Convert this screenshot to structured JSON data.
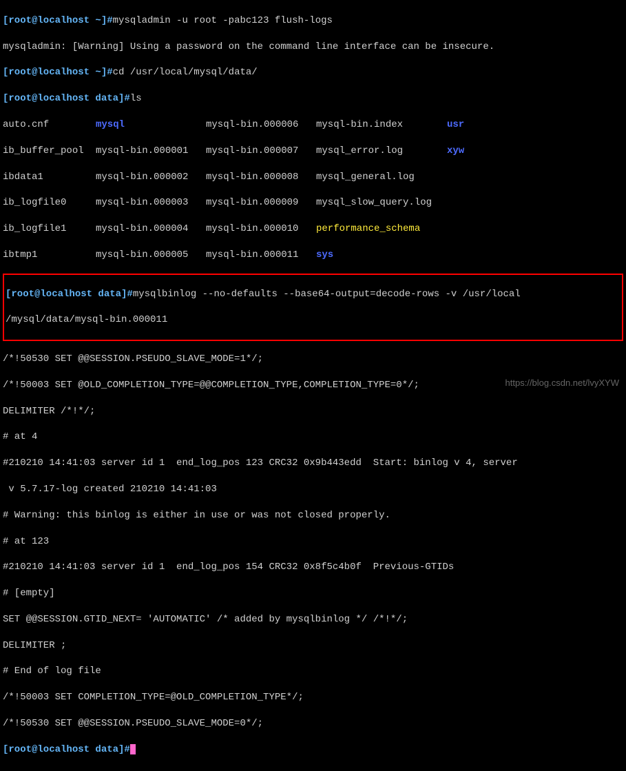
{
  "prompts": {
    "home": "[root@localhost ~]#",
    "data": "[root@localhost data]#"
  },
  "commands": {
    "cmd1": "mysqladmin -u root -pabc123 flush-logs",
    "warning": "mysqladmin: [Warning] Using a password on the command line interface can be insecure.",
    "cmd2": "cd /usr/local/mysql/data/",
    "cmd3": "ls",
    "cmd4_line1": "mysqlbinlog --no-defaults --base64-output=decode-rows -v /usr/local",
    "cmd4_line2": "/mysql/data/mysql-bin.000011"
  },
  "ls": {
    "rows": [
      {
        "c1": "auto.cnf",
        "c2": "mysql",
        "c2cls": "dir",
        "c3": "mysql-bin.000006",
        "c4": "mysql-bin.index",
        "c5": "usr",
        "c5cls": "dir"
      },
      {
        "c1": "ib_buffer_pool",
        "c2": "mysql-bin.000001",
        "c2cls": "",
        "c3": "mysql-bin.000007",
        "c4": "mysql_error.log",
        "c5": "xyw",
        "c5cls": "dir"
      },
      {
        "c1": "ibdata1",
        "c2": "mysql-bin.000002",
        "c2cls": "",
        "c3": "mysql-bin.000008",
        "c4": "mysql_general.log",
        "c5": "",
        "c5cls": ""
      },
      {
        "c1": "ib_logfile0",
        "c2": "mysql-bin.000003",
        "c2cls": "",
        "c3": "mysql-bin.000009",
        "c4": "mysql_slow_query.log",
        "c5": "",
        "c5cls": ""
      },
      {
        "c1": "ib_logfile1",
        "c2": "mysql-bin.000004",
        "c2cls": "",
        "c3": "mysql-bin.000010",
        "c4": "performance_schema",
        "c4cls": "perf",
        "c5": "",
        "c5cls": ""
      },
      {
        "c1": "ibtmp1",
        "c2": "mysql-bin.000005",
        "c2cls": "",
        "c3": "mysql-bin.000011",
        "c4": "sys",
        "c4cls": "sys",
        "c5": "",
        "c5cls": ""
      }
    ]
  },
  "output": {
    "l1": "/*!50530 SET @@SESSION.PSEUDO_SLAVE_MODE=1*/;",
    "l2": "/*!50003 SET @OLD_COMPLETION_TYPE=@@COMPLETION_TYPE,COMPLETION_TYPE=0*/;",
    "l3": "DELIMITER /*!*/;",
    "l4": "# at 4",
    "l5": "#210210 14:41:03 server id 1  end_log_pos 123 CRC32 0x9b443edd  Start: binlog v 4, server",
    "l6": " v 5.7.17-log created 210210 14:41:03",
    "l7": "# Warning: this binlog is either in use or was not closed properly.",
    "l8": "# at 123",
    "l9": "#210210 14:41:03 server id 1  end_log_pos 154 CRC32 0x8f5c4b0f  Previous-GTIDs",
    "l10": "# [empty]",
    "l11": "SET @@SESSION.GTID_NEXT= 'AUTOMATIC' /* added by mysqlbinlog */ /*!*/;",
    "l12": "DELIMITER ;",
    "l13": "# End of log file",
    "l14": "/*!50003 SET COMPLETION_TYPE=@OLD_COMPLETION_TYPE*/;",
    "l15": "/*!50530 SET @@SESSION.PSEUDO_SLAVE_MODE=0*/;"
  },
  "watermark": "https://blog.csdn.net/lvyXYW"
}
